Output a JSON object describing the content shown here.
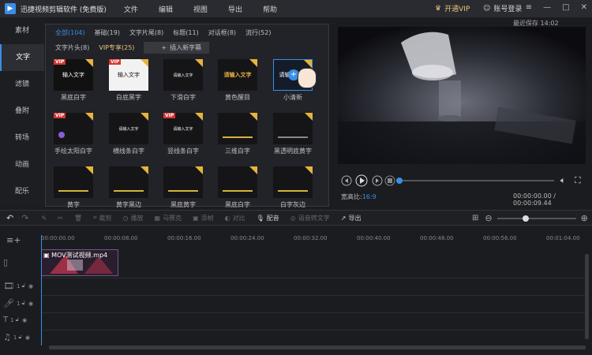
{
  "app": {
    "title": "迅捷视频剪辑软件 (免费版)",
    "menu": [
      "文件",
      "编辑",
      "视图",
      "导出",
      "帮助"
    ],
    "vip_label": "开通VIP",
    "login_label": "账号登录",
    "saved_text": "最近保存 14:02"
  },
  "sidebar": {
    "items": [
      {
        "label": "素材"
      },
      {
        "label": "文字"
      },
      {
        "label": "滤镜"
      },
      {
        "label": "叠附"
      },
      {
        "label": "转场"
      },
      {
        "label": "动画"
      },
      {
        "label": "配乐"
      }
    ]
  },
  "categories": {
    "row1": [
      "全部(104)",
      "基础(19)",
      "文字片尾(8)",
      "标题(11)",
      "对话框(8)",
      "流行(52)"
    ],
    "row2_normal": "文字片头(8)",
    "row2_vip": "VIP专享(25)",
    "insert_button": "插入新字幕"
  },
  "tiles": [
    {
      "label": "黑底白字",
      "preview": "输入文字",
      "vip": true
    },
    {
      "label": "白底黑字",
      "preview": "输入文字",
      "vip": true
    },
    {
      "label": "下滑白字",
      "preview": "请输入文字",
      "vip": false
    },
    {
      "label": "黄色醒目",
      "preview": "请输入文字",
      "vip": false
    },
    {
      "label": "小清新",
      "preview": "请输入文字",
      "vip": false
    },
    {
      "label": "手绘太阳白字",
      "preview": "",
      "vip": true
    },
    {
      "label": "横线条白字",
      "preview": "请输入文字",
      "vip": false
    },
    {
      "label": "竖线条白字",
      "preview": "请输入文字",
      "vip": true
    },
    {
      "label": "三维白字",
      "preview": "",
      "vip": false
    },
    {
      "label": "黑透明底黄字",
      "preview": "",
      "vip": false
    },
    {
      "label": "黄字",
      "preview": "",
      "vip": false
    },
    {
      "label": "黄字黑边",
      "preview": "",
      "vip": false
    },
    {
      "label": "黑底黄字",
      "preview": "",
      "vip": false
    },
    {
      "label": "黑底白字",
      "preview": "",
      "vip": false
    },
    {
      "label": "白字灰边",
      "preview": "",
      "vip": false
    }
  ],
  "player": {
    "ratio_label": "宽高比:",
    "ratio_value": "16:9",
    "timecode": "00:00:00.00 / 00:00:09.44",
    "progress": 0
  },
  "toolbar": {
    "crop": "裁剪",
    "speed": "播放",
    "mosaic": "马赛克",
    "freeze": "添帧",
    "contrast": "对比",
    "voice": "配音",
    "subtitle": "语音转文字",
    "export": "导出"
  },
  "timeline": {
    "ticks": [
      "00:00:00.00",
      "00:00:08.00",
      "00:00:16.00",
      "00:00:24.00",
      "00:00:32.00",
      "00:00:40.00",
      "00:00:48.00",
      "00:00:56.00",
      "00:01:04.00"
    ],
    "clip_name": "MOV测试视频.mp4",
    "track_numbers": [
      "1",
      "1",
      "1",
      "1"
    ]
  },
  "colors": {
    "accent": "#3a8ee6",
    "vip": "#e6c57a",
    "vip_badge": "#d8342f"
  }
}
